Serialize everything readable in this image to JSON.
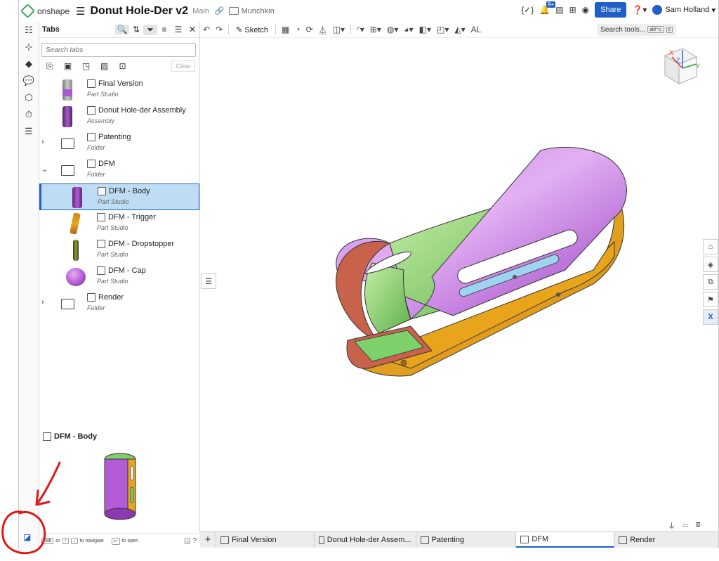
{
  "app": {
    "logo_text": "onshape",
    "doc_title": "Donut Hole-Der v2",
    "branch": "Main",
    "folder": "Munchkin"
  },
  "top_right": {
    "notif_badge": "9+",
    "share_label": "Share",
    "help_label": "?",
    "user_name": "Sam Holland"
  },
  "tabs_panel": {
    "title": "Tabs",
    "search_placeholder": "Search tabs",
    "clear_label": "Clear",
    "items": [
      {
        "name": "Final Version",
        "kind": "Part Studio",
        "expander": ""
      },
      {
        "name": "Donut Hole-der Assembly",
        "kind": "Assembly",
        "expander": ""
      },
      {
        "name": "Patenting",
        "kind": "Folder",
        "expander": "›"
      },
      {
        "name": "DFM",
        "kind": "Folder",
        "expander": "⌄"
      },
      {
        "name": "DFM - Body",
        "kind": "Part Studio",
        "expander": ""
      },
      {
        "name": "DFM - Trigger",
        "kind": "Part Studio",
        "expander": ""
      },
      {
        "name": "DFM - Dropstopper",
        "kind": "Part Studio",
        "expander": ""
      },
      {
        "name": "DFM - Cap",
        "kind": "Part Studio",
        "expander": ""
      },
      {
        "name": "Render",
        "kind": "Folder",
        "expander": "›"
      }
    ],
    "preview_title": "DFM - Body",
    "footer": {
      "tab_key": "Tab",
      "or": "or",
      "up_key": "↑",
      "down_key": "↓",
      "navigate": "to navigate",
      "enter_key": "↵",
      "open": "to open"
    }
  },
  "toolbar": {
    "sketch_label": "Sketch",
    "search_label": "Search tools...",
    "shortcut_1": "alt/⌥",
    "shortcut_2": "c",
    "al_label": "AL"
  },
  "bottom_tabs": [
    {
      "label": "Final Version",
      "active": false
    },
    {
      "label": "Donut Hole-der Assem...",
      "active": false
    },
    {
      "label": "Patenting",
      "active": false
    },
    {
      "label": "DFM",
      "active": true
    },
    {
      "label": "Render",
      "active": false
    }
  ],
  "view_cube": {
    "x": "X",
    "y": "Y",
    "z": "Z"
  },
  "colors": {
    "accent": "#1f5fc6",
    "purple": "#b35ad6",
    "orange": "#e8a51c",
    "green": "#7ed06a"
  }
}
